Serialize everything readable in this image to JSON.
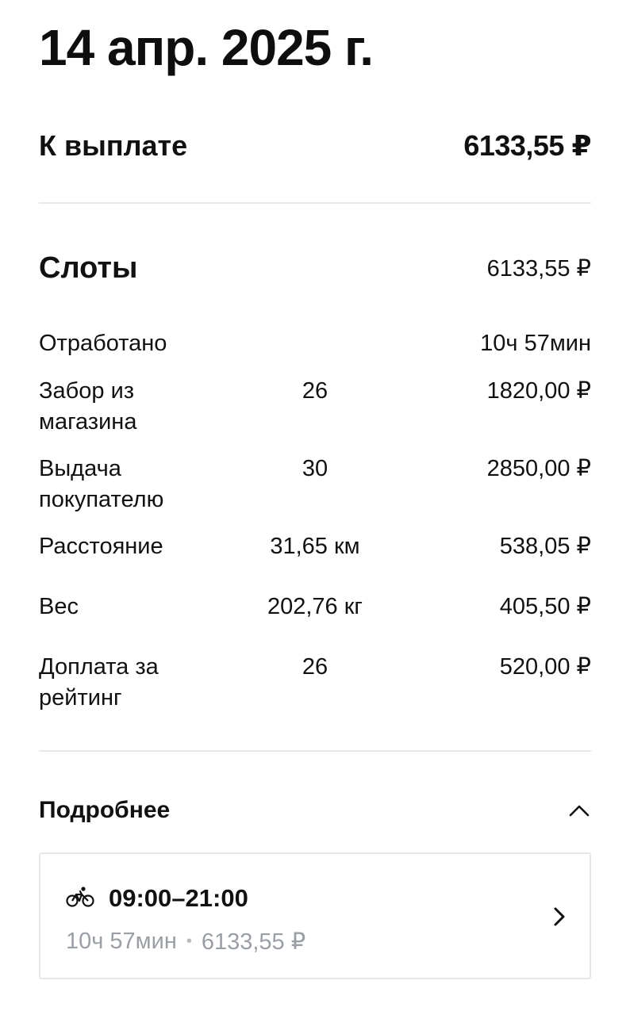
{
  "header": {
    "date": "14 апр. 2025 г."
  },
  "payout": {
    "label": "К выплате",
    "value": "6133,55 ₽"
  },
  "slots": {
    "title": "Слоты",
    "total": "6133,55 ₽",
    "rows": [
      {
        "label": "Отработано",
        "qty": "",
        "amount": "10ч 57мин"
      },
      {
        "label": "Забор из магазина",
        "qty": "26",
        "amount": "1820,00 ₽"
      },
      {
        "label": "Выдача покупателю",
        "qty": "30",
        "amount": "2850,00 ₽"
      },
      {
        "label": "Расстояние",
        "qty": "31,65 км",
        "amount": "538,05 ₽"
      },
      {
        "label": "Вес",
        "qty": "202,76 кг",
        "amount": "405,50 ₽"
      },
      {
        "label": "Доплата за рейтинг",
        "qty": "26",
        "amount": "520,00 ₽"
      }
    ]
  },
  "details": {
    "title": "Подробнее",
    "expand_icon": "chevron-up-icon",
    "slot_card": {
      "icon": "bicycle-icon",
      "time": "09:00–21:00",
      "duration": "10ч 57мин",
      "separator": "•",
      "amount": "6133,55 ₽",
      "open_icon": "chevron-right-icon"
    }
  },
  "colors": {
    "text": "#111111",
    "muted": "#9a9ea5",
    "divider": "#e6e8eb",
    "card_border": "#e3e6ea"
  }
}
